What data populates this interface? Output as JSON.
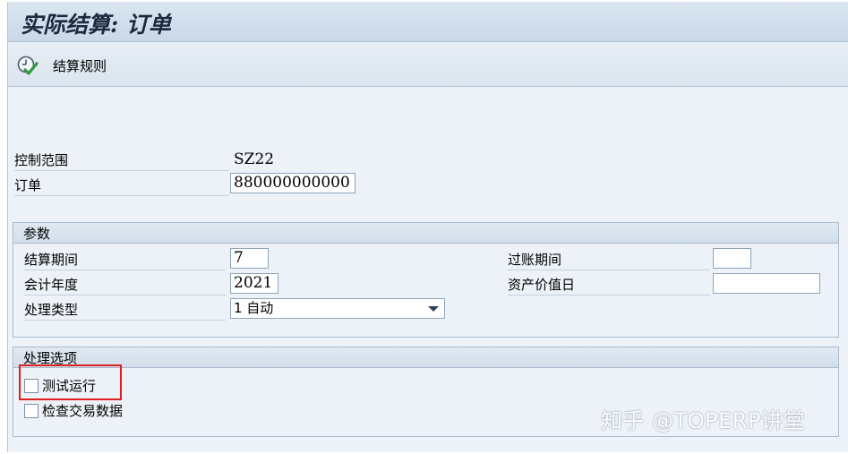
{
  "window": {
    "title": "实际结算: 订单"
  },
  "toolbar": {
    "settlement_rule_label": "结算规则"
  },
  "header_fields": {
    "controlling_area": {
      "label": "控制范围",
      "value": "SZ22"
    },
    "order": {
      "label": "订单",
      "value": "880000000000"
    }
  },
  "parameters": {
    "title": "参数",
    "settlement_period": {
      "label": "结算期间",
      "value": "7"
    },
    "posting_period": {
      "label": "过账期间",
      "value": ""
    },
    "fiscal_year": {
      "label": "会计年度",
      "value": "2021"
    },
    "asset_value_date": {
      "label": "资产价值日",
      "value": ""
    },
    "processing_type": {
      "label": "处理类型",
      "value": "1 自动"
    }
  },
  "processing_options": {
    "title": "处理选项",
    "test_run": {
      "label": "测试运行",
      "checked": false
    },
    "check_trans_data": {
      "label": "检查交易数据",
      "checked": false
    }
  },
  "watermark": {
    "text": "知乎 @TOPERP讲堂"
  },
  "colors": {
    "highlight": "#e02020",
    "accent": "#2e9a3a"
  }
}
